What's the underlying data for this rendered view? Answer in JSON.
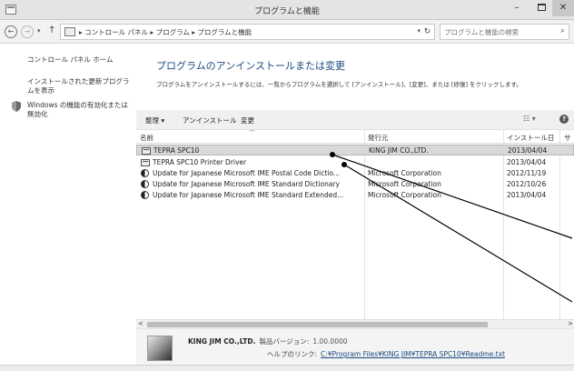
{
  "window": {
    "title": "プログラムと機能",
    "min_glyph": "–",
    "max_glyph": "",
    "close_glyph": "✕"
  },
  "address": {
    "breadcrumb": "▸ コントロール パネル ▸ プログラム ▸ プログラムと機能",
    "back_glyph": "←",
    "forward_glyph": "→",
    "dropdown_glyph": "▾",
    "up_glyph": "↑",
    "refresh_glyph": "↻",
    "search_placeholder": "プログラムと機能の検索",
    "search_glyph": "⌕"
  },
  "sidebar": {
    "items": [
      {
        "label": "コントロール パネル ホーム"
      },
      {
        "label": "インストールされた更新プログラムを表示"
      },
      {
        "label": "Windows の機能の有効化または無効化"
      }
    ]
  },
  "main": {
    "title": "プログラムのアンインストールまたは変更",
    "description": "プログラムをアンインストールするには、一覧からプログラムを選択して [アンインストール]、[変更]、または [修復] をクリックします。"
  },
  "toolbar": {
    "organize": "整理 ▾",
    "uninstall": "アンインストール",
    "change": "変更",
    "view_glyph": "☷ ▾",
    "help_glyph": "?"
  },
  "list": {
    "headers": {
      "name": "名前",
      "publisher": "発行元",
      "installed": "インストール日",
      "size": "サイ"
    },
    "sort_glyph": "^",
    "rows": [
      {
        "name": "TEPRA SPC10",
        "publisher": "KING JIM CO.,LTD.",
        "installed": "2013/04/04",
        "icon": "program-icon",
        "selected": true
      },
      {
        "name": "TEPRA SPC10 Printer Driver",
        "publisher": "",
        "installed": "2013/04/04",
        "icon": "program-icon",
        "selected": false
      },
      {
        "name": "Update for Japanese Microsoft IME Postal Code Dictio...",
        "publisher": "Microsoft Corporation",
        "installed": "2012/11/19",
        "icon": "ime-icon",
        "selected": false
      },
      {
        "name": "Update for Japanese Microsoft IME Standard Dictionary",
        "publisher": "Microsoft Corporation",
        "installed": "2012/10/26",
        "icon": "ime-icon",
        "selected": false
      },
      {
        "name": "Update for Japanese Microsoft IME Standard Extended...",
        "publisher": "Microsoft Corporation",
        "installed": "2013/04/04",
        "icon": "ime-icon",
        "selected": false
      }
    ]
  },
  "scrollbar": {
    "left_glyph": "<",
    "right_glyph": ">"
  },
  "details": {
    "publisher": "KING JIM CO.,LTD.",
    "version_label": "製品バージョン:",
    "version_value": "1.00.0000",
    "help_label": "ヘルプのリンク:",
    "help_link": "C:¥Program Files¥KING JIM¥TEPRA SPC10¥Readme.txt"
  }
}
